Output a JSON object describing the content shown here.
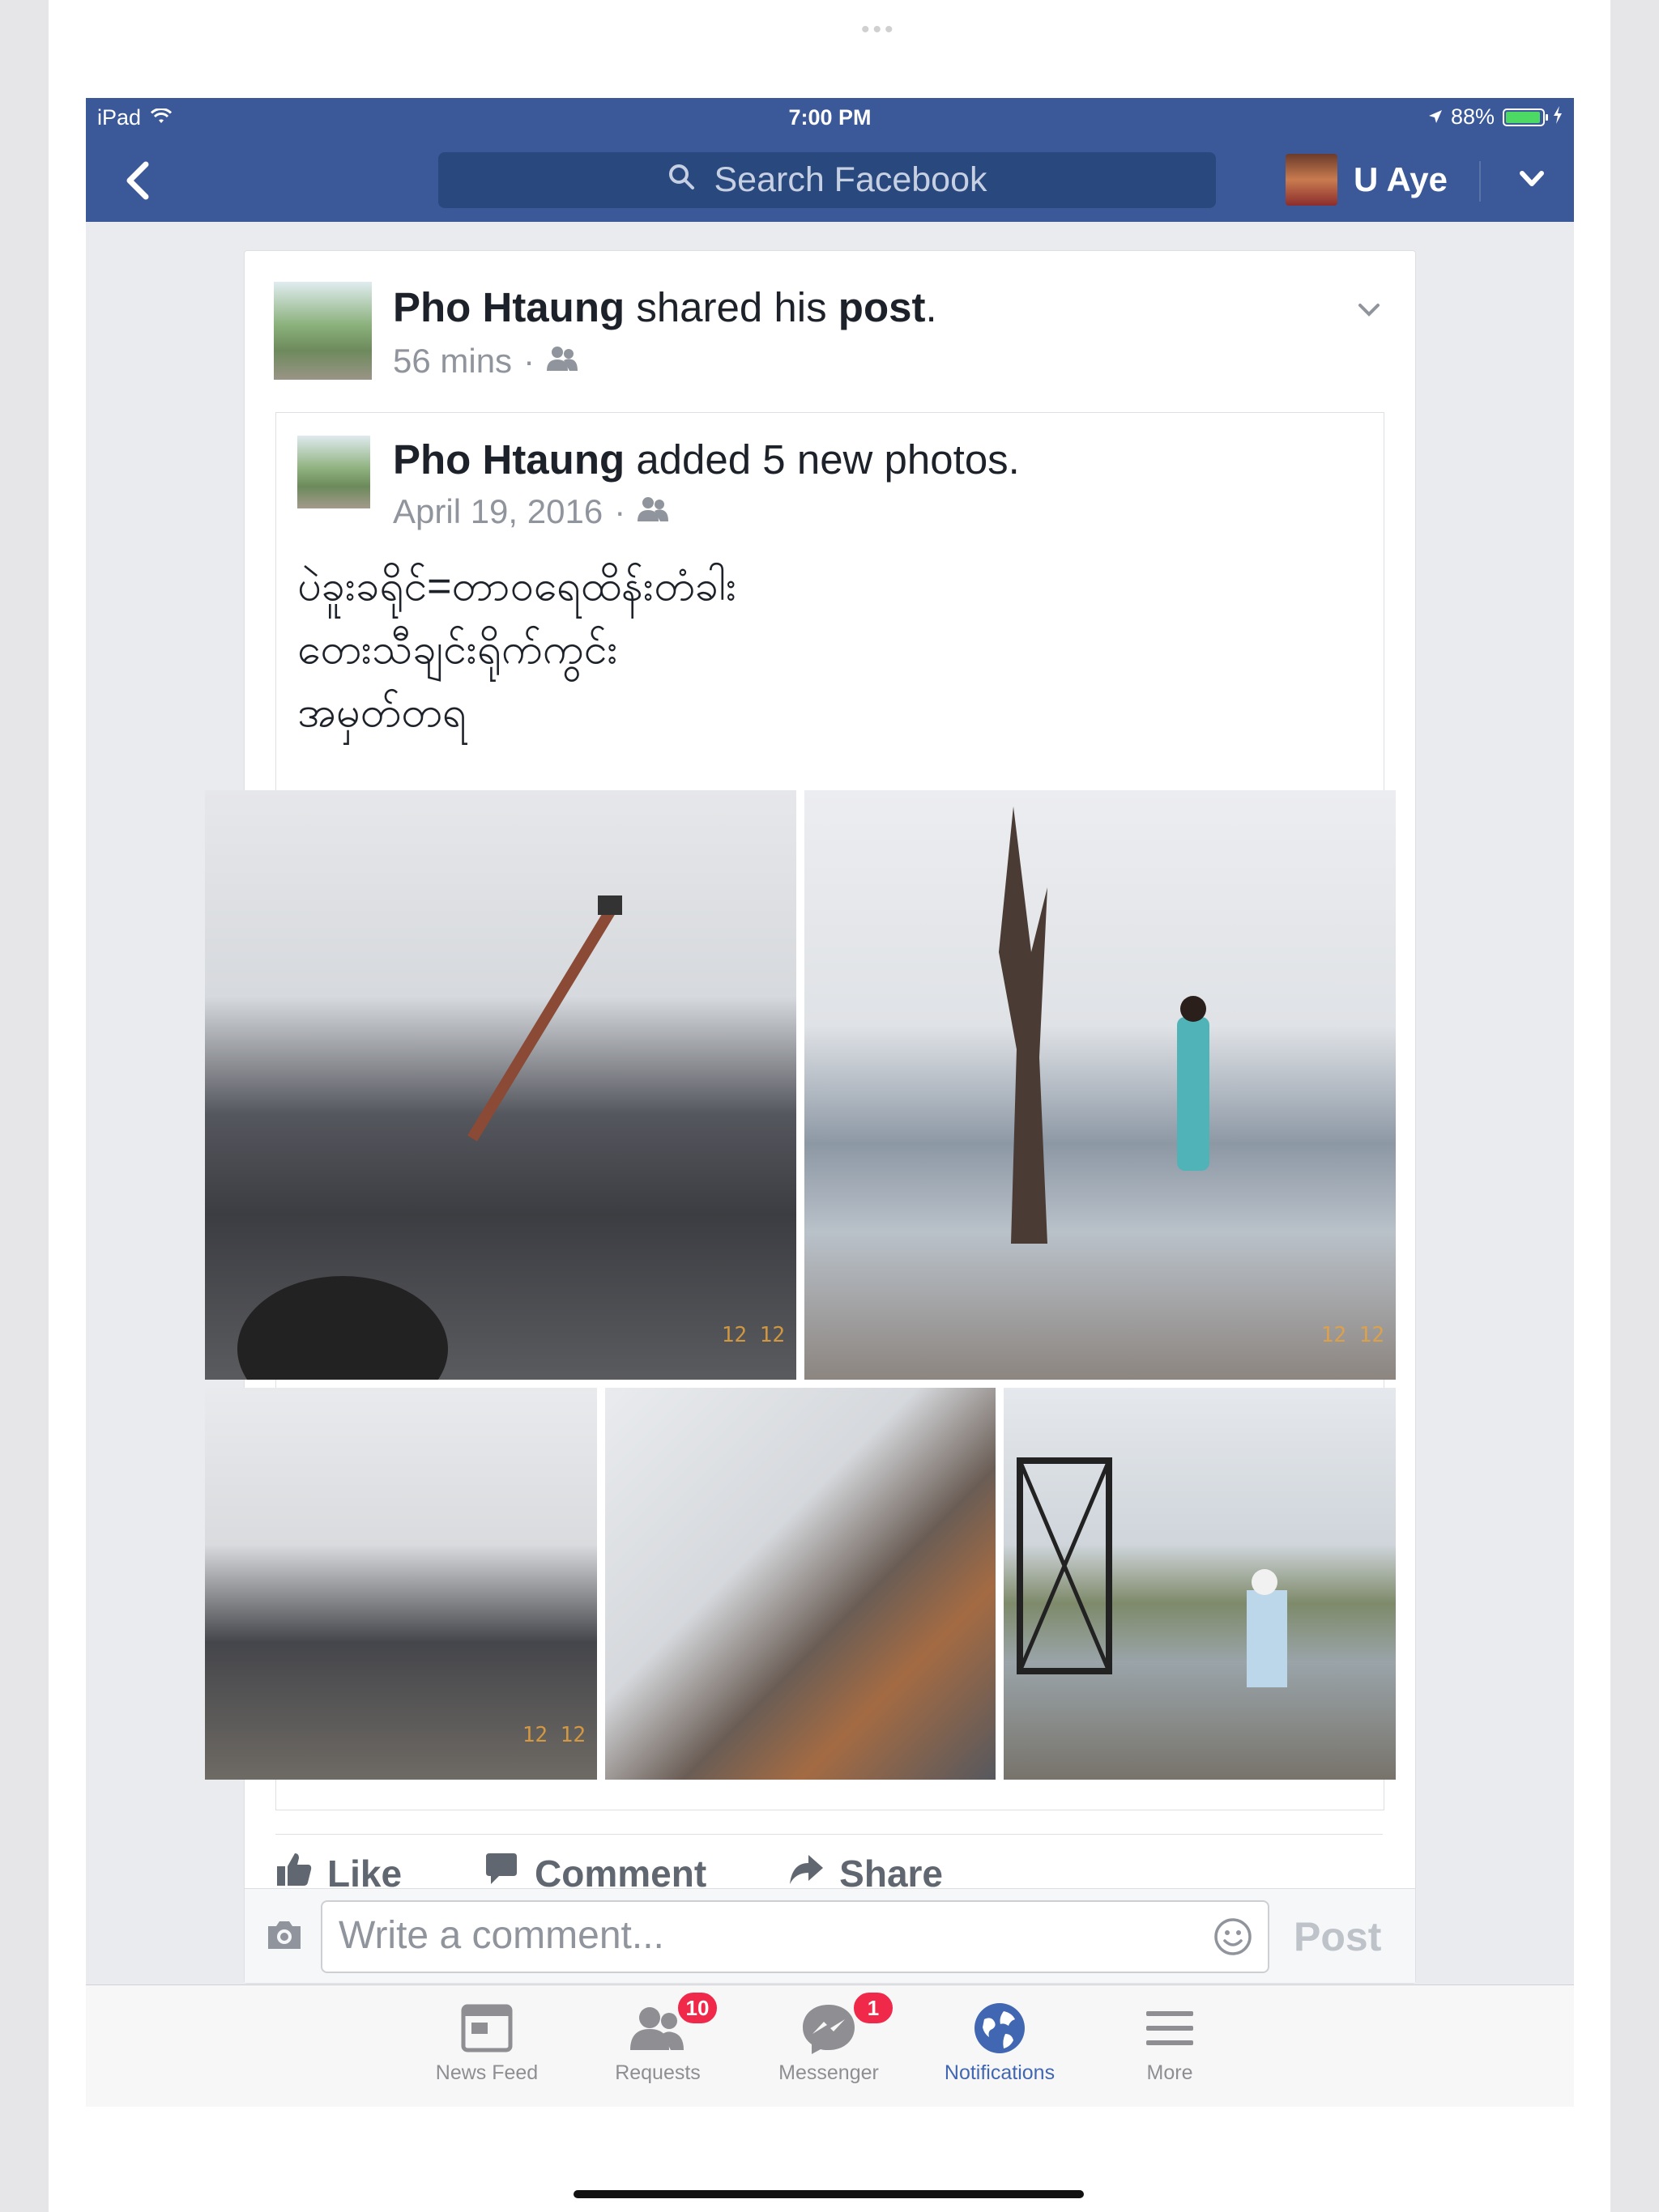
{
  "status_bar": {
    "device": "iPad",
    "time": "7:00 PM",
    "battery": "88%",
    "battery_level": 0.88
  },
  "nav": {
    "search_placeholder": "Search Facebook",
    "user_name": "U Aye"
  },
  "post": {
    "author": "Pho Htaung",
    "action_pre": "shared his",
    "action_post": "post",
    "time": "56 mins",
    "dot": "·",
    "shared": {
      "author": "Pho Htaung",
      "action": "added 5 new photos.",
      "date": "April 19, 2016",
      "text_lines": [
        "ပဲခူးခရိုင်=တာဝရေထိန်းတံခါး",
        "တေးသီချင်းရိုက်ကွင်း",
        "အမှတ်တရ"
      ],
      "photo_timestamps": [
        "12 12",
        "12 12",
        "12 12"
      ]
    },
    "actions": {
      "like": "Like",
      "comment": "Comment",
      "share": "Share"
    },
    "comment_placeholder": "Write a comment...",
    "post_button": "Post"
  },
  "tabbar": {
    "tabs": [
      {
        "label": "News Feed",
        "badge": ""
      },
      {
        "label": "Requests",
        "badge": "10"
      },
      {
        "label": "Messenger",
        "badge": "1"
      },
      {
        "label": "Notifications",
        "badge": ""
      },
      {
        "label": "More",
        "badge": ""
      }
    ],
    "active": "Notifications"
  },
  "colors": {
    "brand": "#3b5998",
    "active_tab": "#4267b2",
    "badge": "#f02849"
  }
}
